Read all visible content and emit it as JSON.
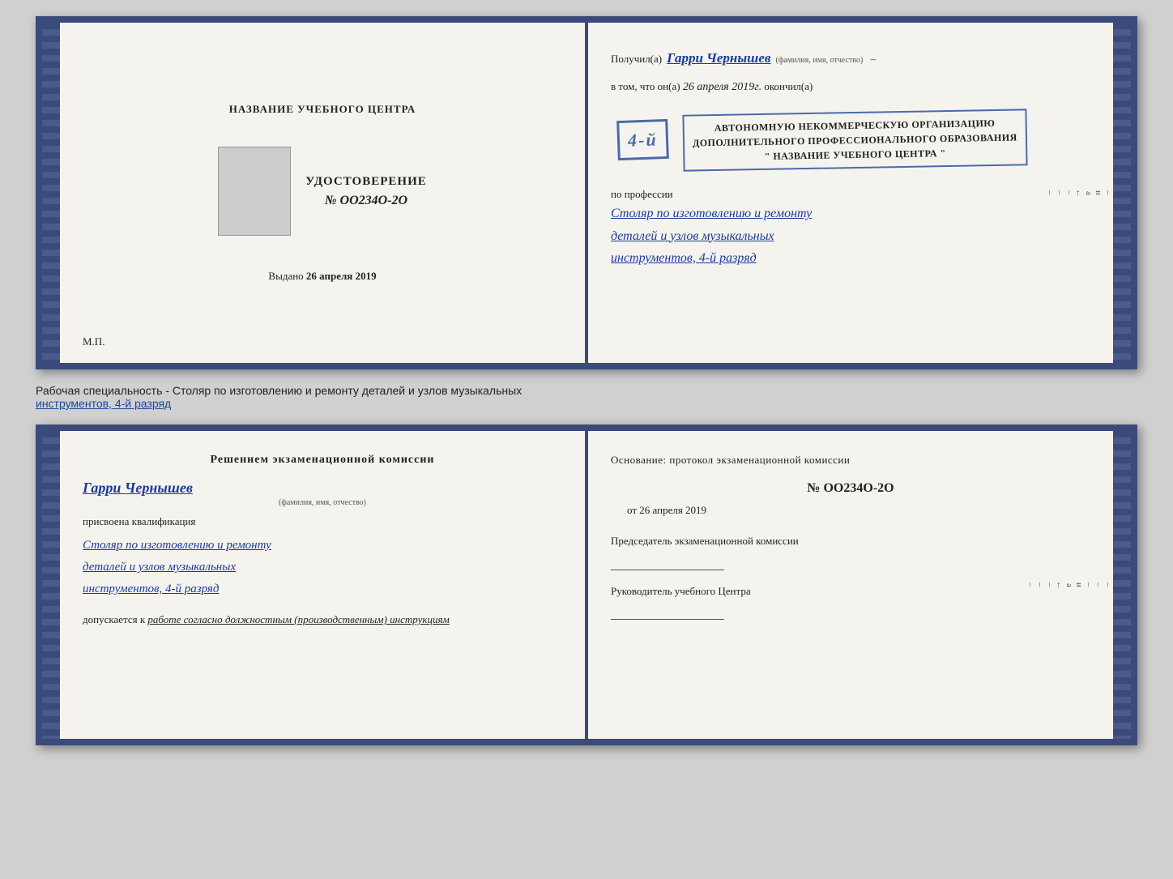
{
  "top_spread": {
    "left": {
      "training_center_label": "НАЗВАНИЕ УЧЕБНОГО ЦЕНТРА",
      "photo_alt": "фото",
      "udost_title": "УДОСТОВЕРЕНИЕ",
      "udost_number": "№ OO234O-2O",
      "issued_label": "Выдано",
      "issued_date": "26 апреля 2019",
      "mp_label": "М.П."
    },
    "right": {
      "received_prefix": "Получил(а)",
      "recipient_name": "Гарри Чернышев",
      "name_hint": "(фамилия, имя, отчество)",
      "vtom_prefix": "в том, что он(а)",
      "vtom_date": "26 апреля 2019г.",
      "vtom_suffix": "окончил(а)",
      "grade_label": "4-й",
      "org_line1": "АВТОНОМНУЮ НЕКОММЕРЧЕСКУЮ ОРГАНИЗАЦИЮ",
      "org_line2": "ДОПОЛНИТЕЛЬНОГО ПРОФЕССИОНАЛЬНОГО ОБРАЗОВАНИЯ",
      "org_line3": "\" НАЗВАНИЕ УЧЕБНОГО ЦЕНТРА \"",
      "po_professii": "по профессии",
      "profession_line1": "Столяр по изготовлению и ремонту",
      "profession_line2": "деталей и узлов музыкальных",
      "profession_line3": "инструментов, 4-й разряд"
    }
  },
  "description": {
    "text_normal": "Рабочая специальность - Столяр по изготовлению и ремонту деталей и узлов музыкальных",
    "text_underlined": "инструментов, 4-й разряд"
  },
  "bottom_spread": {
    "left": {
      "decision_title": "Решением  экзаменационной  комиссии",
      "name": "Гарри Чернышев",
      "name_hint": "(фамилия, имя, отчество)",
      "prisvoena": "присвоена квалификация",
      "profession_line1": "Столяр по изготовлению и ремонту",
      "profession_line2": "деталей и узлов музыкальных",
      "profession_line3": "инструментов, 4-й разряд",
      "dopusk_prefix": "допускается к",
      "dopusk_italic": "работе согласно должностным (производственным) инструкциям"
    },
    "right": {
      "osnov_title": "Основание: протокол экзаменационной  комиссии",
      "protocol_number": "№  OO234O-2O",
      "ot_label": "от",
      "protocol_date": "26 апреля 2019",
      "chairman_title": "Председатель экзаменационной комиссии",
      "rukevod_title": "Руководитель учебного Центра"
    }
  }
}
